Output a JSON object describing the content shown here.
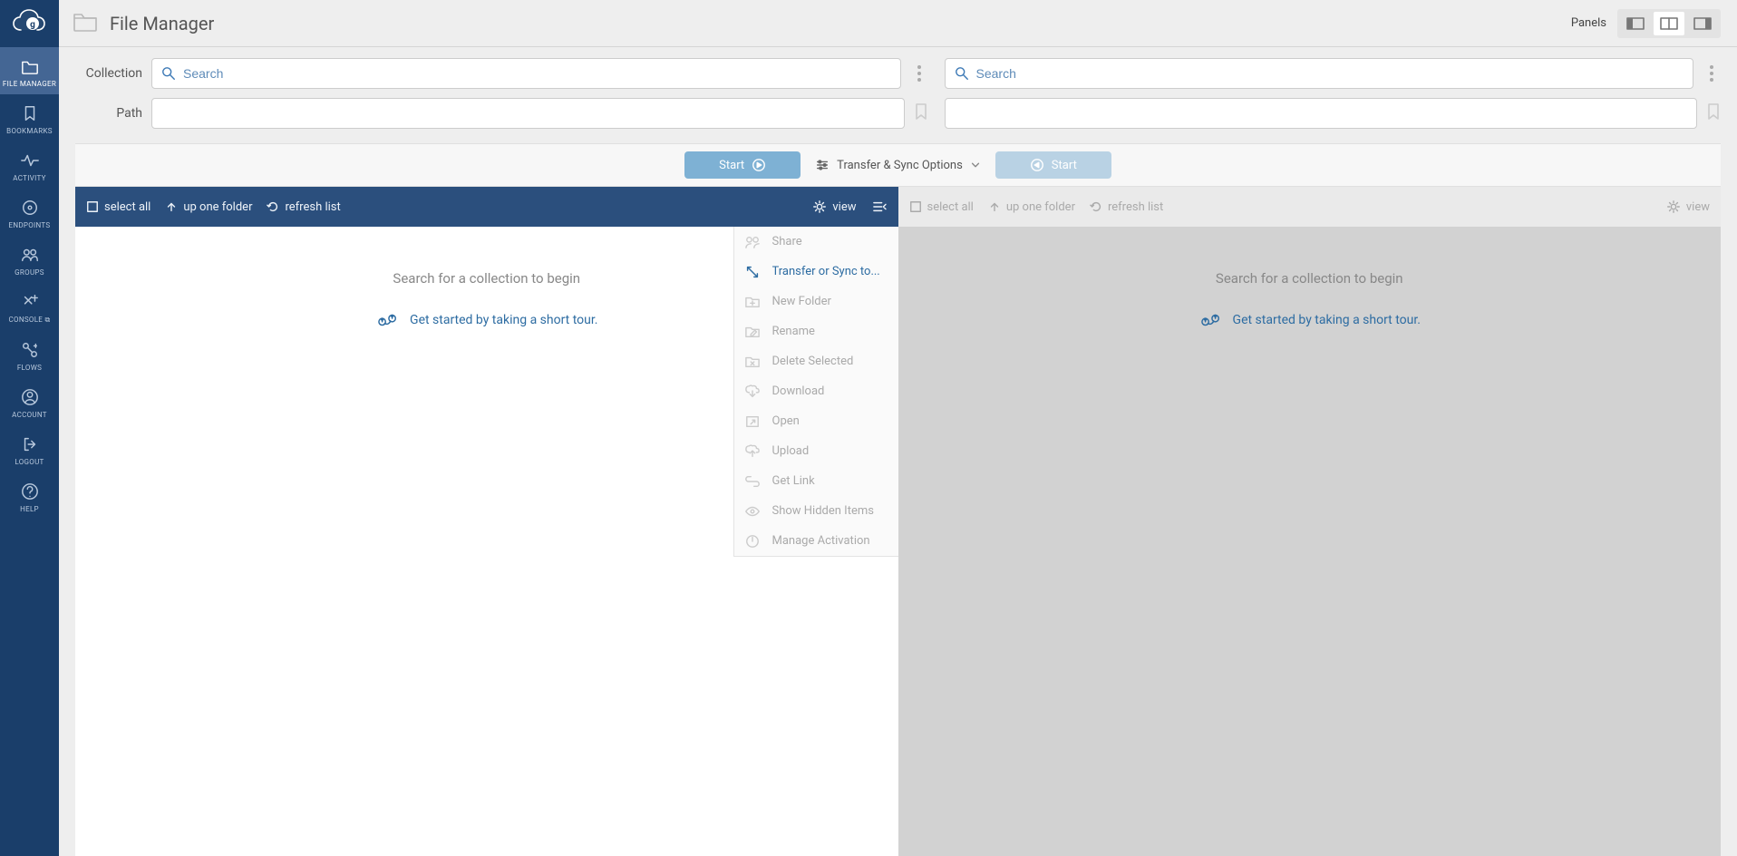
{
  "sidebar": {
    "items": [
      {
        "label": "FILE MANAGER",
        "icon": "folder"
      },
      {
        "label": "BOOKMARKS",
        "icon": "bookmark"
      },
      {
        "label": "ACTIVITY",
        "icon": "activity"
      },
      {
        "label": "ENDPOINTS",
        "icon": "disc"
      },
      {
        "label": "GROUPS",
        "icon": "groups"
      },
      {
        "label": "CONSOLE ⧉",
        "icon": "console"
      },
      {
        "label": "FLOWS",
        "icon": "flows"
      },
      {
        "label": "ACCOUNT",
        "icon": "user"
      },
      {
        "label": "LOGOUT",
        "icon": "logout"
      },
      {
        "label": "HELP",
        "icon": "help"
      }
    ]
  },
  "header": {
    "title": "File Manager",
    "panels_label": "Panels"
  },
  "search": {
    "collection_label": "Collection",
    "path_label": "Path",
    "search_placeholder": "Search"
  },
  "transfer": {
    "start": "Start",
    "options": "Transfer & Sync Options"
  },
  "toolbar": {
    "select_all": "select all",
    "up_one": "up one folder",
    "refresh": "refresh list",
    "view": "view"
  },
  "empty": {
    "message": "Search for a collection to begin",
    "tour": "Get started by taking a short tour."
  },
  "view_menu": [
    {
      "label": "Share",
      "icon": "share"
    },
    {
      "label": "Transfer or Sync to...",
      "icon": "transfer",
      "active": true
    },
    {
      "label": "New Folder",
      "icon": "newfolder"
    },
    {
      "label": "Rename",
      "icon": "rename"
    },
    {
      "label": "Delete Selected",
      "icon": "delete"
    },
    {
      "label": "Download",
      "icon": "download"
    },
    {
      "label": "Open",
      "icon": "open"
    },
    {
      "label": "Upload",
      "icon": "upload"
    },
    {
      "label": "Get Link",
      "icon": "link"
    },
    {
      "label": "Show Hidden Items",
      "icon": "eye"
    },
    {
      "label": "Manage Activation",
      "icon": "power"
    }
  ]
}
